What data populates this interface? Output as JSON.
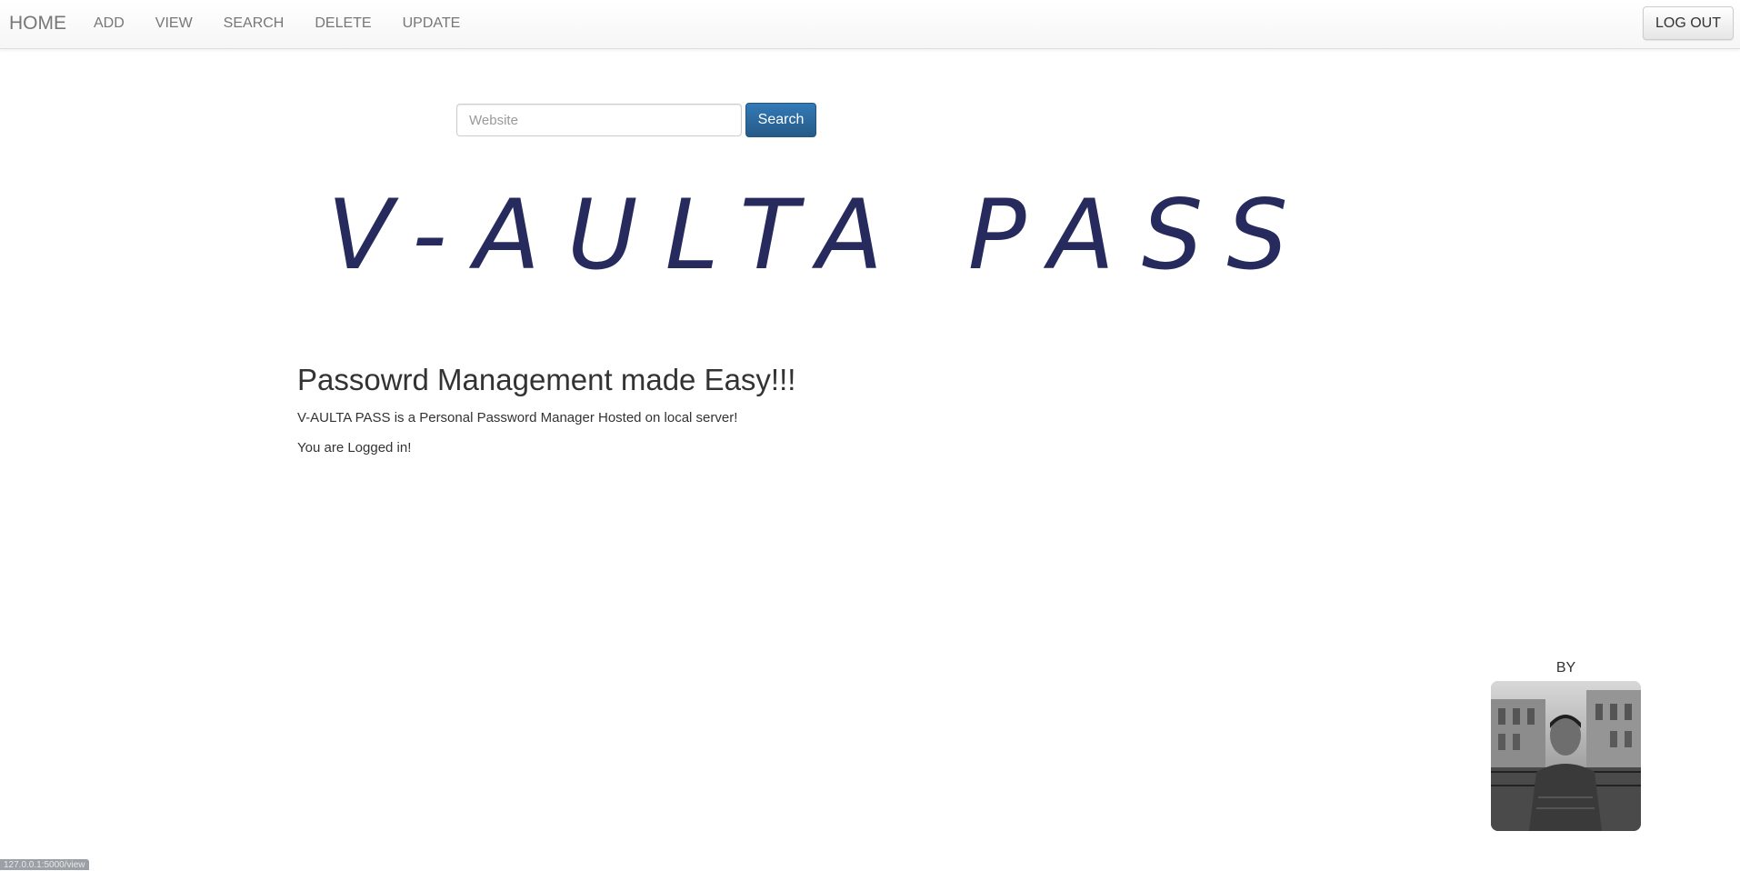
{
  "nav": {
    "brand": "HOME",
    "links": [
      "ADD",
      "VIEW",
      "SEARCH",
      "DELETE",
      "UPDATE"
    ],
    "logout_label": "LOG OUT"
  },
  "search": {
    "placeholder": "Website",
    "button_label": "Search"
  },
  "logo": {
    "text": "V-AULTA PASS"
  },
  "main": {
    "heading": "Passowrd Management made Easy!!!",
    "description": "V-AULTA PASS is a Personal Password Manager Hosted on local server!",
    "status": "You are Logged in!"
  },
  "author": {
    "label": "BY"
  },
  "statusbar": {
    "url": "127.0.0.1:5000/view"
  },
  "colors": {
    "logo": "#262a5c",
    "primary_button": "#337ab7"
  }
}
